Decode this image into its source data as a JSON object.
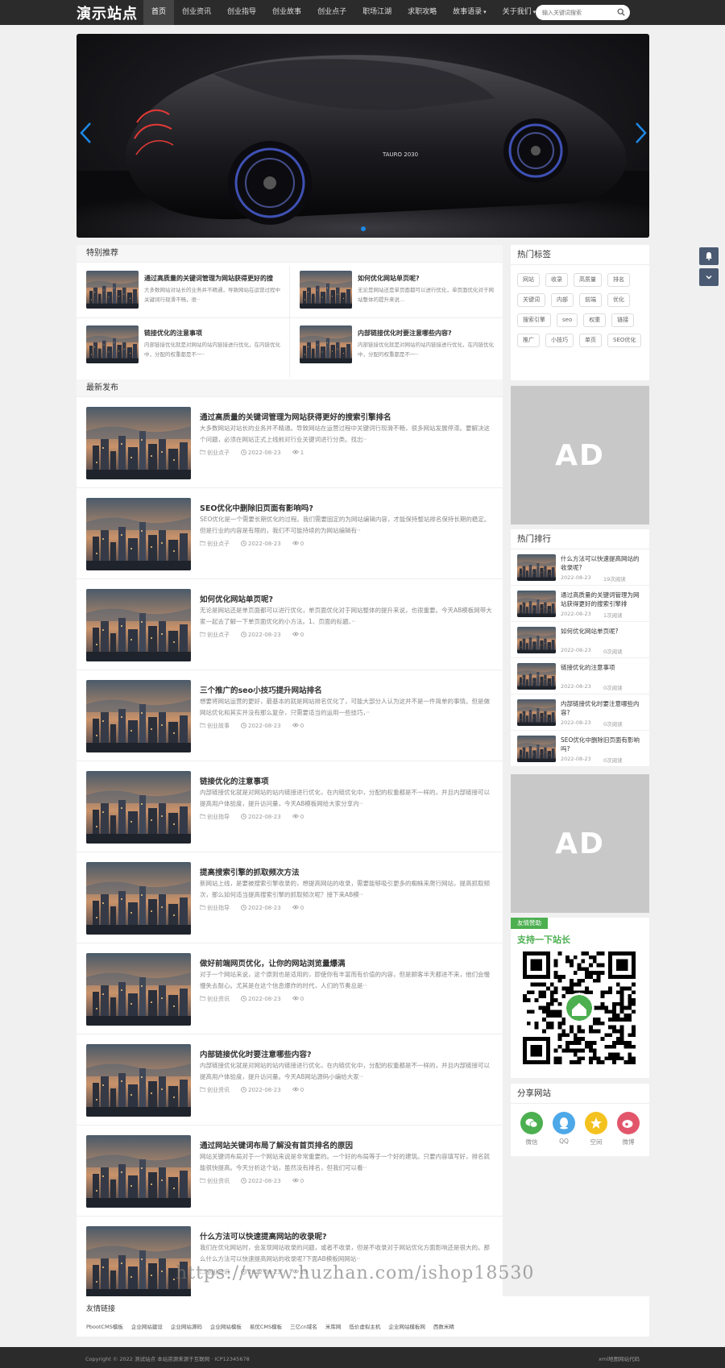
{
  "site": {
    "logo": "演示站点"
  },
  "nav": {
    "items": [
      {
        "label": "首页",
        "active": true
      },
      {
        "label": "创业资讯"
      },
      {
        "label": "创业指导"
      },
      {
        "label": "创业故事"
      },
      {
        "label": "创业点子"
      },
      {
        "label": "职场江湖"
      },
      {
        "label": "求职攻略"
      },
      {
        "label": "故事语录",
        "dropdown": true
      },
      {
        "label": "关于我们",
        "dropdown": true
      }
    ],
    "search_placeholder": "输入关键词搜索"
  },
  "banner": {
    "caption": "TAURO 2030"
  },
  "special": {
    "title": "特别推荐",
    "items": [
      {
        "title": "通过高质量的关键词管理为网站获得更好的搜",
        "desc": "大多数网站对站长的业务并不精通，导致网站在运营过程中关键词行现滑不畅，很··"
      },
      {
        "title": "如何优化网站单页呢?",
        "desc": "无论是网站还是单页面都可以进行优化，单页面优化对于网站整体的提升来说..."
      },
      {
        "title": "链接优化的注意事项",
        "desc": "内部链接优化就是对网站的站内链接进行优化，在内链优化中，分配的权重都是不一··"
      },
      {
        "title": "内部链接优化时要注意哪些内容?",
        "desc": "内部链接优化就是对网站的站内链接进行优化，在内链优化中，分配的权重都是不一··"
      }
    ]
  },
  "latest": {
    "title": "最新发布",
    "items": [
      {
        "title": "通过高质量的关键词管理为网站获得更好的搜索引擎排名",
        "desc": "大多数网站对站长的业务并不精通。导致网站在运营过程中关键词行现滑不畅，很多网站发展停滞。要解决这个问题，必须在网站正式上线前对行业关键词进行分类。找出··",
        "cat": "创业点子",
        "date": "2022-08-23",
        "views": "1"
      },
      {
        "title": "SEO优化中删除旧页面有影响吗?",
        "desc": "SEO优化是一个需要长期优化的过程。我们需要固定的为网站编辑内容，才能保持整站排名保持长期的稳定。但是行业的内容是有限的，我们不可能持续的为网站编辑有··",
        "cat": "创业点子",
        "date": "2022-08-23",
        "views": "0"
      },
      {
        "title": "如何优化网站单页呢?",
        "desc": "无论是网站还是单页面都可以进行优化，单页面优化对于网站整体的提升来说，也很重要。今天AB模板网带大家一起去了解一下单页面优化的小方法。1、页面的标题、··",
        "cat": "创业点子",
        "date": "2022-08-23",
        "views": "0"
      },
      {
        "title": "三个推广的seo小技巧提升网站排名",
        "desc": "想要将网站运营的更好，最基本的就是网站排名优化了，可能大部分人认为这并不是一件简单的事情。但是做网站优化和其实并没有那么复杂，只需要适当的运用一些技巧，··",
        "cat": "创业故事",
        "date": "2022-08-23",
        "views": "0"
      },
      {
        "title": "链接优化的注意事项",
        "desc": "内部链接优化就是对网站的站内链接进行优化，在内链优化中，分配的权重都是不一样的，并且内部链接可以提高用户体验度，提升访问量，今天AB模板网给大家分享内··",
        "cat": "创业指导",
        "date": "2022-08-23",
        "views": "0"
      },
      {
        "title": "提高搜索引擎的抓取频次方法",
        "desc": "新网站上线，是要被搜索引擎收录的，想提高网站的收录，需要能够吸引更多的蜘蛛来爬行网站，提高抓取频次，那么如何适当提高搜索引擎的抓取频次呢？接下来AB模··",
        "cat": "创业指导",
        "date": "2022-08-23",
        "views": "0"
      },
      {
        "title": "做好前端网页优化，让你的网站浏览量爆满",
        "desc": "对于一个网站来说，这个原则也是适用的，即使你有丰富而有价值的内容，但是顾客半天都进不来，他们会慢慢失去耐心。尤其是在这个信息爆炸的时代，人们的节奏总是··",
        "cat": "创业资讯",
        "date": "2022-08-23",
        "views": "0"
      },
      {
        "title": "内部链接优化时要注意哪些内容?",
        "desc": "内部链接优化就是对网站的站内链接进行优化，在内链优化中，分配的权重都是不一样的，并且内部链接可以提高用户体验度，提升访问量。今天AB网站源码小编给大家··",
        "cat": "创业资讯",
        "date": "2022-08-23",
        "views": "0"
      },
      {
        "title": "通过网站关键词布局了解没有首页排名的原因",
        "desc": "网站关键词布局对于一个网站来说是非常重要的。一个好的布局等于一个好的建筑。只要内容填写好，排名就能很快提高。今天分析这个站，虽然没有排名，但我们可以看··",
        "cat": "创业资讯",
        "date": "2022-08-23",
        "views": "0"
      },
      {
        "title": "什么方法可以快速提高网站的收录呢?",
        "desc": "我们在优化网站时，会发现网站收录的问题，或者不收录，但是不收录对于网站优化方面影响还是很大的。那么什么方法可以快速提高网站的收录呢?下面AB模板网网站··",
        "cat": "创业资讯",
        "date": "2022-08-23",
        "views": "19"
      }
    ]
  },
  "sidebar": {
    "tags_title": "热门标签",
    "tags": [
      "网站",
      "收录",
      "高质量",
      "排名",
      "关键词",
      "内部",
      "前端",
      "优化",
      "搜索引擎",
      "seo",
      "权重",
      "链接",
      "推广",
      "小技巧",
      "单页",
      "SEO优化"
    ],
    "ad_label": "AD",
    "hot_title": "热门排行",
    "hot": [
      {
        "title": "什么方法可以快速提高网站的收录呢?",
        "date": "2022-08-23",
        "views": "19次阅读"
      },
      {
        "title": "通过高质量的关键词管理为网站获得更好的搜索引擎排",
        "date": "2022-08-23",
        "views": "1次阅读"
      },
      {
        "title": "如何优化网站单页呢?",
        "date": "2022-08-23",
        "views": "0次阅读"
      },
      {
        "title": "链接优化的注意事项",
        "date": "2022-08-23",
        "views": "0次阅读"
      },
      {
        "title": "内部链接优化时要注意哪些内容?",
        "date": "2022-08-23",
        "views": "0次阅读"
      },
      {
        "title": "SEO优化中删除旧页面有影响吗?",
        "date": "2022-08-23",
        "views": "0次阅读"
      }
    ],
    "donate_badge": "友情赞助",
    "donate_text": "支持一下站长",
    "share_title": "分享网站",
    "share": [
      {
        "label": "微信",
        "color": "#4caf50"
      },
      {
        "label": "QQ",
        "color": "#4da8e8"
      },
      {
        "label": "空间",
        "color": "#f4c21f"
      },
      {
        "label": "微博",
        "color": "#e2566b"
      }
    ]
  },
  "links": {
    "title": "友情链接",
    "items": [
      "PbootCMS模板",
      "企业网站建设",
      "企业网站源码",
      "企业网站模板",
      "易优CMS模板",
      "三亿cn域名",
      "米库网",
      "低价虚拟主机",
      "企业网站模板网",
      "西数米精"
    ]
  },
  "footer": {
    "copyright": "Copyright © 2022 测试站点 本站资源来源于互联网 · ICP12345678",
    "stat": "xml地图网站代码"
  },
  "watermark": "https://www.huzhan.com/ishop18530"
}
